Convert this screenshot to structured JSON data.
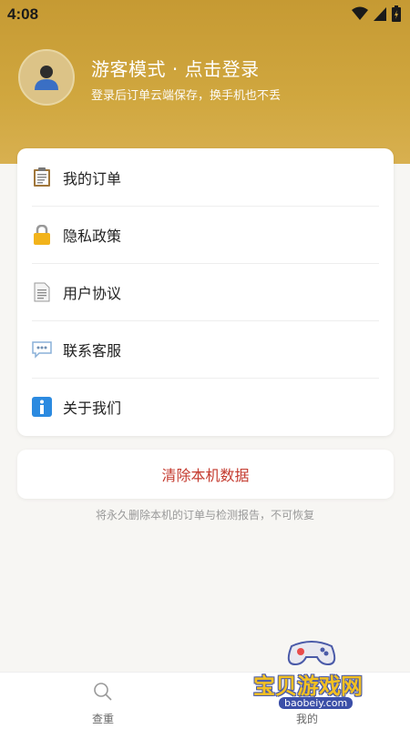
{
  "status_bar": {
    "time": "4:08"
  },
  "profile": {
    "title": "游客模式 · 点击登录",
    "subtitle": "登录后订单云端保存，换手机也不丢"
  },
  "menu": {
    "items": [
      {
        "label": "我的订单",
        "icon": "clipboard-icon"
      },
      {
        "label": "隐私政策",
        "icon": "lock-icon"
      },
      {
        "label": "用户协议",
        "icon": "document-icon"
      },
      {
        "label": "联系客服",
        "icon": "speech-bubble-icon"
      },
      {
        "label": "关于我们",
        "icon": "info-icon"
      }
    ]
  },
  "clear_data": {
    "label": "清除本机数据",
    "warning": "将永久删除本机的订单与检测报告，不可恢复"
  },
  "bottom_nav": {
    "items": [
      {
        "label": "查重",
        "icon": "search-icon"
      },
      {
        "label": "我的",
        "icon": "user-icon"
      }
    ]
  },
  "watermark": {
    "text": "宝贝游戏网",
    "url": "baobeiy.com"
  },
  "colors": {
    "header": "#c69a33",
    "danger": "#c43b2f"
  }
}
